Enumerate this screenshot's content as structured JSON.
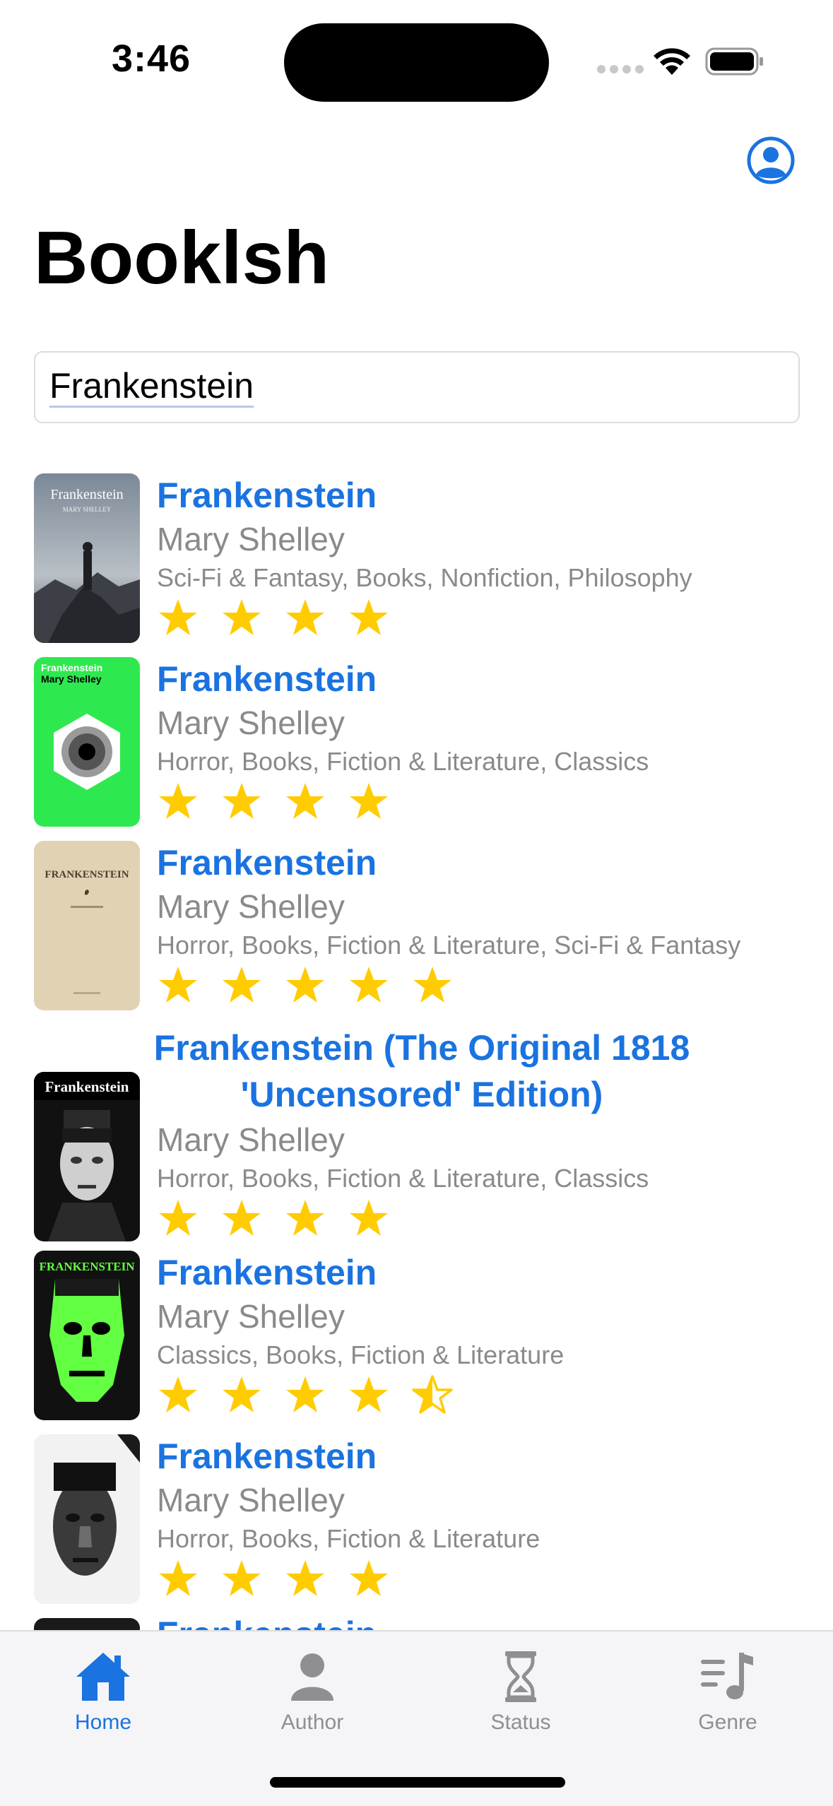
{
  "status_bar": {
    "time": "3:46"
  },
  "header": {
    "title": "Booklsh",
    "profile_icon": "person-circle-icon"
  },
  "search": {
    "value": "Frankenstein"
  },
  "colors": {
    "accent": "#1a73e0",
    "star": "#ffcc00",
    "secondary_text": "#8a8a8a"
  },
  "books": [
    {
      "title": "Frankenstein",
      "author": "Mary Shelley",
      "genres": "Sci-Fi & Fantasy, Books, Nonfiction, Philosophy",
      "rating": 4,
      "cover_text": "Frankenstein",
      "cover_subtext": "MARY SHELLEY"
    },
    {
      "title": "Frankenstein",
      "author": "Mary Shelley",
      "genres": "Horror, Books, Fiction & Literature, Classics",
      "rating": 4,
      "cover_text": "Frankenstein",
      "cover_subtext": "Mary Shelley"
    },
    {
      "title": "Frankenstein",
      "author": "Mary Shelley",
      "genres": "Horror, Books, Fiction & Literature, Sci-Fi & Fantasy",
      "rating": 5,
      "cover_text": "FRANKENSTEIN",
      "cover_subtext": ""
    },
    {
      "title": "Frankenstein (The Original 1818 'Uncensored' Edition)",
      "author": "Mary Shelley",
      "genres": "Horror, Books, Fiction & Literature, Classics",
      "rating": 4,
      "cover_text": "Frankenstein",
      "cover_subtext": ""
    },
    {
      "title": "Frankenstein",
      "author": "Mary Shelley",
      "genres": "Classics, Books, Fiction & Literature",
      "rating": 4.5,
      "cover_text": "FRANKENSTEIN",
      "cover_subtext": ""
    },
    {
      "title": "Frankenstein",
      "author": "Mary Shelley",
      "genres": "Horror, Books, Fiction & Literature",
      "rating": 4,
      "cover_text": "",
      "cover_subtext": ""
    },
    {
      "title": "Frankenstein",
      "author": "",
      "genres": "",
      "rating": 0,
      "cover_text": "",
      "cover_subtext": ""
    }
  ],
  "tabs": [
    {
      "label": "Home",
      "icon": "house-icon",
      "active": true
    },
    {
      "label": "Author",
      "icon": "person-icon",
      "active": false
    },
    {
      "label": "Status",
      "icon": "hourglass-icon",
      "active": false
    },
    {
      "label": "Genre",
      "icon": "music-list-icon",
      "active": false
    }
  ]
}
